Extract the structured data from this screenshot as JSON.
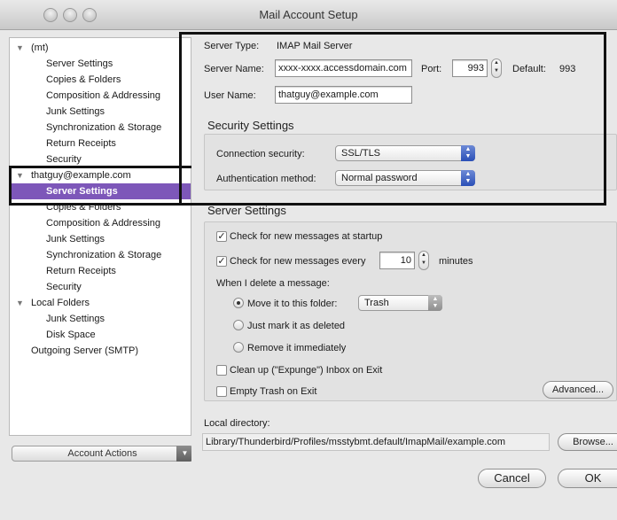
{
  "window": {
    "title": "Mail Account Setup"
  },
  "sidebar": {
    "items": [
      {
        "label": "(mt)",
        "level": 0,
        "expanded": true
      },
      {
        "label": "Server Settings",
        "level": 1
      },
      {
        "label": "Copies & Folders",
        "level": 1
      },
      {
        "label": "Composition & Addressing",
        "level": 1
      },
      {
        "label": "Junk Settings",
        "level": 1
      },
      {
        "label": "Synchronization & Storage",
        "level": 1
      },
      {
        "label": "Return Receipts",
        "level": 1
      },
      {
        "label": "Security",
        "level": 1
      },
      {
        "label": "thatguy@example.com",
        "level": 0,
        "expanded": true
      },
      {
        "label": "Server Settings",
        "level": 1,
        "selected": true
      },
      {
        "label": "Copies & Folders",
        "level": 1
      },
      {
        "label": "Composition & Addressing",
        "level": 1
      },
      {
        "label": "Junk Settings",
        "level": 1
      },
      {
        "label": "Synchronization & Storage",
        "level": 1
      },
      {
        "label": "Return Receipts",
        "level": 1
      },
      {
        "label": "Security",
        "level": 1
      },
      {
        "label": "Local Folders",
        "level": 0,
        "expanded": true
      },
      {
        "label": "Junk Settings",
        "level": 1
      },
      {
        "label": "Disk Space",
        "level": 1
      },
      {
        "label": "Outgoing Server (SMTP)",
        "level": 0
      }
    ],
    "account_actions_label": "Account Actions"
  },
  "server": {
    "server_type_label": "Server Type:",
    "server_type_value": "IMAP Mail Server",
    "server_name_label": "Server Name:",
    "server_name_value": "xxxx-xxxx.accessdomain.com",
    "port_label": "Port:",
    "port_value": "993",
    "default_label": "Default:",
    "default_value": "993",
    "user_name_label": "User Name:",
    "user_name_value": "thatguy@example.com"
  },
  "security": {
    "title": "Security Settings",
    "connection_label": "Connection security:",
    "connection_value": "SSL/TLS",
    "auth_label": "Authentication method:",
    "auth_value": "Normal password"
  },
  "server_settings": {
    "title": "Server Settings",
    "check_startup_label": "Check for new messages at startup",
    "check_startup_checked": true,
    "check_every_label": "Check for new messages every",
    "check_every_checked": true,
    "check_every_value": "10",
    "minutes_label": "minutes",
    "delete_label": "When I delete a message:",
    "move_label": "Move it to this folder:",
    "move_folder_value": "Trash",
    "mark_deleted_label": "Just mark it as deleted",
    "remove_label": "Remove it immediately",
    "expunge_label": "Clean up (\"Expunge\") Inbox on Exit",
    "empty_trash_label": "Empty Trash on Exit",
    "advanced_label": "Advanced..."
  },
  "local": {
    "dir_label": "Local directory:",
    "dir_value": "Library/Thunderbird/Profiles/msstybmt.default/ImapMail/example.com",
    "browse_label": "Browse..."
  },
  "footer": {
    "cancel_label": "Cancel",
    "ok_label": "OK"
  },
  "colors": {
    "selection": "#7d57b9",
    "highlight_border": "#111111"
  }
}
